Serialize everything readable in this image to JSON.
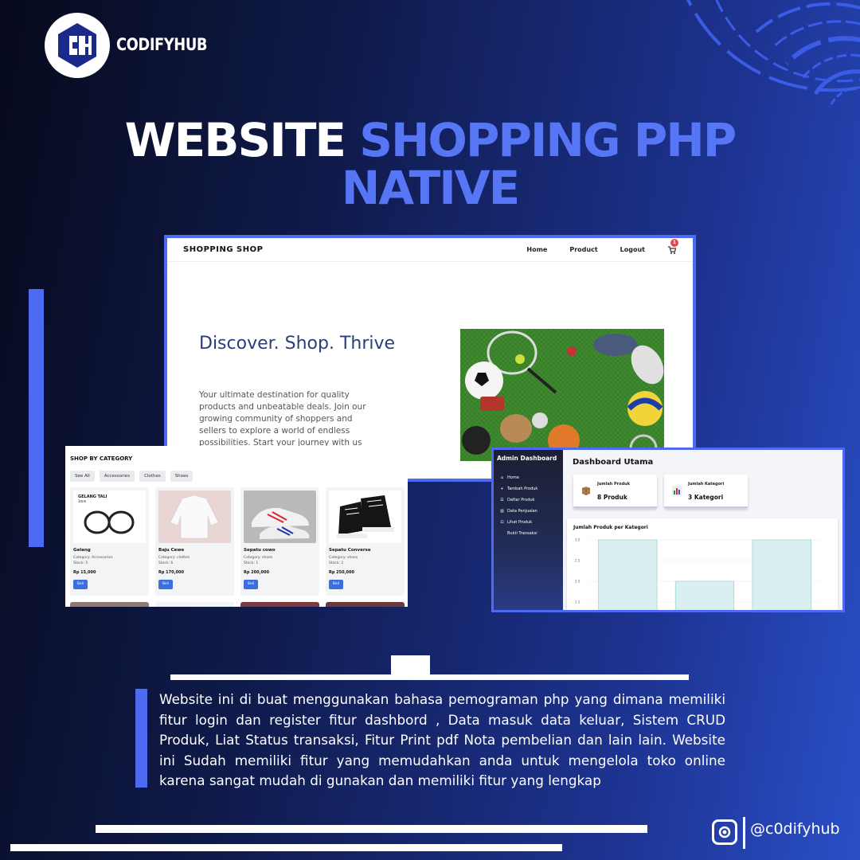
{
  "brand": {
    "name": "CODIFYHUB"
  },
  "title": {
    "white_part": "WEBSITE",
    "blue_part_1": "SHOPPING PHP",
    "blue_part_2": "NATIVE"
  },
  "shop_screenshot": {
    "brand": "SHOPPING SHOP",
    "nav": [
      "Home",
      "Product",
      "Logout"
    ],
    "cart_count": "1",
    "hero_heading": "Discover. Shop. Thrive",
    "hero_text": "Your ultimate destination for quality products and unbeatable deals. Join our growing community of shoppers and sellers to explore a world of endless possibilities. Start your journey with us"
  },
  "category_screenshot": {
    "title": "SHOP BY CATEGORY",
    "filters": [
      "See All",
      "Accessories",
      "Clothes",
      "Shoes"
    ],
    "products": [
      {
        "name": "Gelang",
        "category": "Category: Accessories",
        "stock": "Stock: 5",
        "price": "Rp 15,000",
        "button": "Beli"
      },
      {
        "name": "Baju Cewe",
        "category": "Category: clothes",
        "stock": "Stock: 6",
        "price": "Rp 170,000",
        "button": "Beli"
      },
      {
        "name": "Sepatu cowo",
        "category": "Category: shoes",
        "stock": "Stock: 1",
        "price": "Rp 200,000",
        "button": "Beli"
      },
      {
        "name": "Sepatu Converse",
        "category": "Category: shoes",
        "stock": "Stock: 2",
        "price": "Rp 250,000",
        "button": "Beli"
      }
    ],
    "product_image_text": {
      "line1": "GELANG TALI",
      "line2": "3mm"
    }
  },
  "admin_screenshot": {
    "sidebar_title": "Admin Dashboard",
    "menu": [
      {
        "icon": "home-icon",
        "label": "Home"
      },
      {
        "icon": "plus-icon",
        "label": "Tambah Produk"
      },
      {
        "icon": "list-icon",
        "label": "Daftar Produk"
      },
      {
        "icon": "chart-icon",
        "label": "Data Penjualan"
      },
      {
        "icon": "cart-icon",
        "label": "Lihat Produk"
      },
      {
        "icon": "",
        "label": "Bukti Transaksi"
      }
    ],
    "main_title": "Dashboard Utama",
    "stats": [
      {
        "label": "Jumlah Produk",
        "value": "8 Produk"
      },
      {
        "label": "Jumlah Kategori",
        "value": "3 Kategori"
      }
    ],
    "chart_title": "Jumlah Produk per Kategori"
  },
  "chart_data": {
    "type": "bar",
    "title": "Jumlah Produk per Kategori",
    "categories": [
      "",
      "",
      ""
    ],
    "values": [
      3.0,
      2.0,
      3.0
    ],
    "ytick_labels": [
      "3.0",
      "2.5",
      "2.0",
      "1.5"
    ],
    "ylim": [
      1.5,
      3.0
    ],
    "bar_color": "#d9eff0"
  },
  "description": "Website ini di buat menggunakan bahasa pemograman php yang dimana memiliki fitur login dan register fitur dashbord , Data masuk data keluar, Sistem CRUD Produk, Liat Status transaksi, Fitur Print pdf Nota pembelian dan lain lain. Website ini Sudah memiliki fitur yang memudahkan anda untuk mengelola toko online karena sangat mudah di gunakan dan memiliki fitur yang lengkap",
  "social": {
    "icon": "instagram-icon",
    "handle": "@c0difyhub"
  },
  "colors": {
    "accent": "#4e6af3",
    "title_blue": "#5676f5",
    "bg_dark": "#070a1c",
    "bg_blue": "#2a4fc7"
  }
}
